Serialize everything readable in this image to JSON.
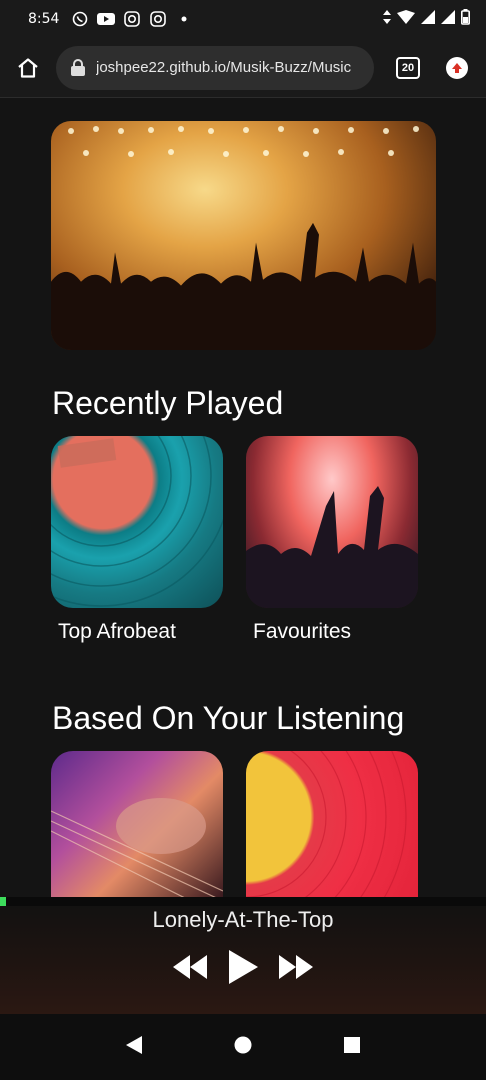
{
  "status_bar": {
    "time": "8:54",
    "left_icons": [
      "whatsapp-icon",
      "youtube-icon",
      "instagram-icon",
      "instagram-icon",
      "dot-icon"
    ],
    "right_icons": [
      "data-arrows-icon",
      "wifi-icon",
      "signal-icon",
      "signal-icon",
      "battery-icon"
    ]
  },
  "browser": {
    "url": "joshpee22.github.io/Musik-Buzz/Music",
    "tab_count": "20"
  },
  "main": {
    "sections": [
      {
        "title": "Recently Played",
        "items": [
          {
            "label": "Top Afrobeat"
          },
          {
            "label": "Favourites"
          }
        ]
      },
      {
        "title": "Based On Your Listening",
        "items": [
          {
            "label": ""
          },
          {
            "label": ""
          }
        ]
      }
    ]
  },
  "player": {
    "song_title": "Lonely-At-The-Top",
    "progress": 0.012,
    "controls": [
      "rewind-icon",
      "play-icon",
      "fast-forward-icon"
    ]
  },
  "colors": {
    "background": "#141414",
    "progress": "#3ddc5c",
    "url_box": "#2e2e2e"
  }
}
